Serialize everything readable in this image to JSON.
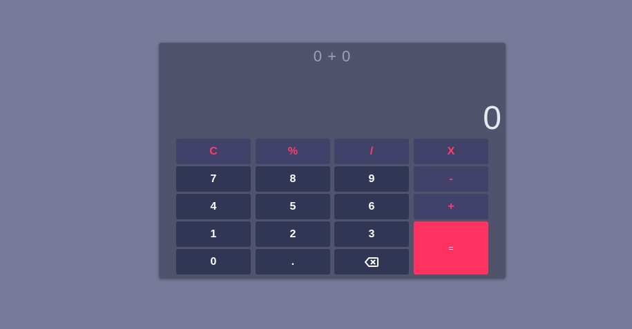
{
  "display": {
    "expression": "0 + 0",
    "result": "0"
  },
  "keys": {
    "clear": "C",
    "percent": "%",
    "divide": "/",
    "multiply": "X",
    "seven": "7",
    "eight": "8",
    "nine": "9",
    "minus": "-",
    "four": "4",
    "five": "5",
    "six": "6",
    "plus": "+",
    "one": "1",
    "two": "2",
    "three": "3",
    "equals": "=",
    "zero": "0",
    "decimal": ".",
    "backspace_icon": "backspace-icon"
  },
  "colors": {
    "background": "#767a98",
    "panel": "#4f536c",
    "operator_key": "#41426a",
    "number_key": "#303653",
    "accent": "#ff3262"
  }
}
